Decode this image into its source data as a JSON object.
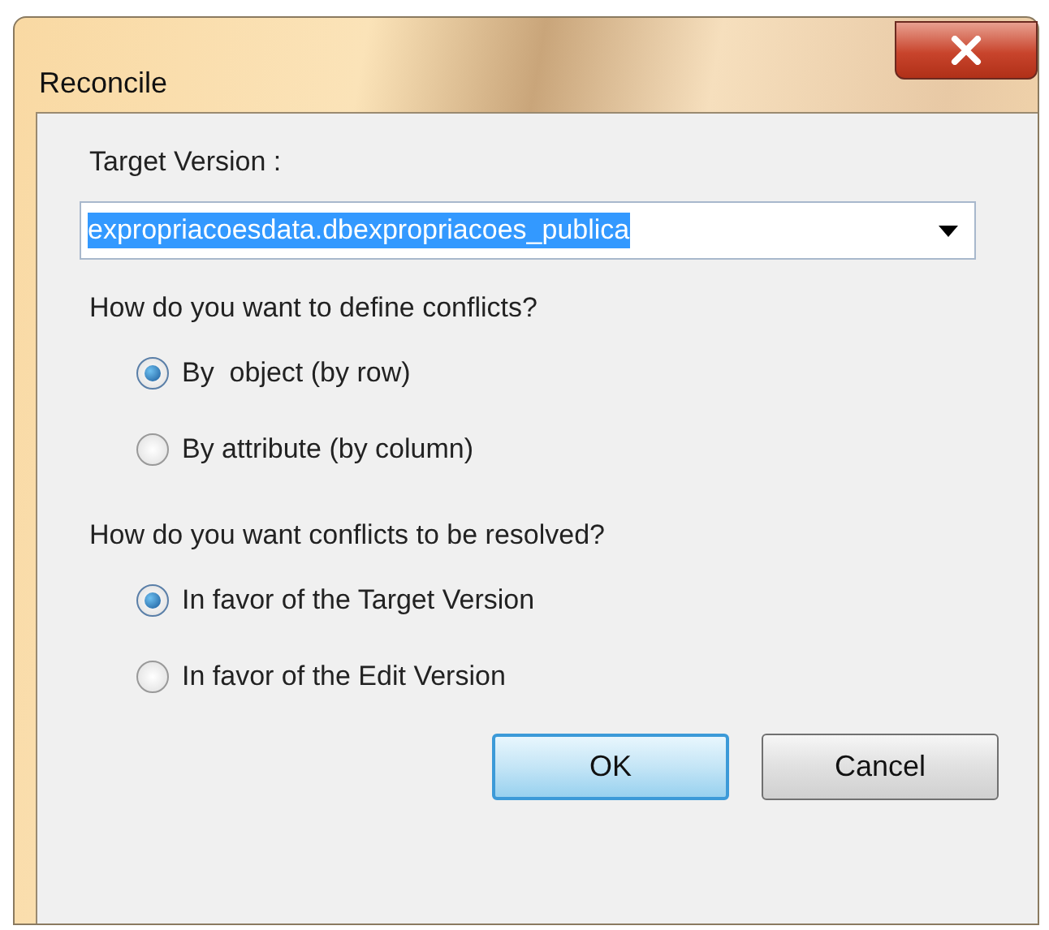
{
  "window": {
    "title": "Reconcile"
  },
  "target_version": {
    "label": "Target Version :",
    "value": "expropriacoesdata.dbexpropriacoes_publica",
    "highlighted": true
  },
  "groups": [
    {
      "question": "How do you want to define conflicts?",
      "options": [
        {
          "label": "By  object (by row)",
          "selected": true
        },
        {
          "label": "By attribute (by column)",
          "selected": false
        }
      ]
    },
    {
      "question": "How do you want conflicts to be resolved?",
      "options": [
        {
          "label": "In favor of the Target Version",
          "selected": true
        },
        {
          "label": "In favor of the Edit Version",
          "selected": false
        }
      ]
    }
  ],
  "buttons": [
    {
      "label": "OK",
      "default": true
    },
    {
      "label": "Cancel",
      "default": false
    }
  ]
}
